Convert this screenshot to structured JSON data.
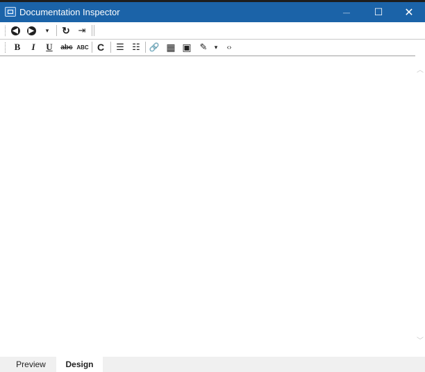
{
  "window": {
    "title": "Documentation Inspector",
    "controls": {
      "minimize": "─",
      "maximize": "☐",
      "close": "✕"
    }
  },
  "toolbar_nav": {
    "back_icon": "◀",
    "forward_icon": "▶",
    "dropdown_icon": "▾",
    "refresh_icon": "↻",
    "import_icon": "⇥"
  },
  "toolbar_format": {
    "bold": "B",
    "italic": "I",
    "underline": "U",
    "strikethrough": "abc",
    "spellcheck": "ABC",
    "code": "C",
    "bullets_icon": "☰",
    "numbering_icon": "☷",
    "link_icon": "🔗",
    "table_icon": "▦",
    "image_icon": "▣",
    "edit_icon": "✎",
    "edit_dropdown_icon": "▾",
    "source_icon": "‹›"
  },
  "tabs": [
    {
      "label": "Preview",
      "selected": false
    },
    {
      "label": "Design",
      "selected": true
    }
  ],
  "colors": {
    "titlebar": "#1b63a8",
    "tabbar": "#f0f0f0"
  }
}
